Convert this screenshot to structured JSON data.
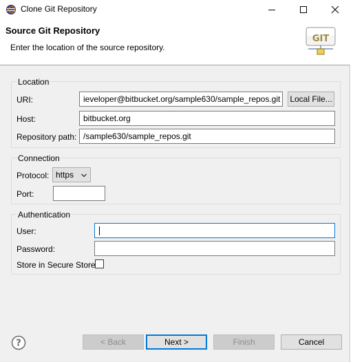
{
  "window": {
    "title": "Clone Git Repository"
  },
  "banner": {
    "title": "Source Git Repository",
    "description": "Enter the location of the source repository.",
    "logo_text": "GIT"
  },
  "location": {
    "group_title": "Location",
    "uri_label": "URI:",
    "uri_value": "ieveloper@bitbucket.org/sample630/sample_repos.git",
    "local_file_button": "Local File...",
    "host_label": "Host:",
    "host_value": "bitbucket.org",
    "repo_path_label": "Repository path:",
    "repo_path_value": "/sample630/sample_repos.git"
  },
  "connection": {
    "group_title": "Connection",
    "protocol_label": "Protocol:",
    "protocol_value": "https",
    "port_label": "Port:",
    "port_value": ""
  },
  "authentication": {
    "group_title": "Authentication",
    "user_label": "User:",
    "user_value": "",
    "password_label": "Password:",
    "password_value": "",
    "store_label": "Store in Secure Store",
    "store_checked": false
  },
  "buttons": {
    "back": "< Back",
    "next": "Next >",
    "finish": "Finish",
    "cancel": "Cancel"
  },
  "icons": {
    "app": "eclipse-icon",
    "help": "help-icon",
    "minimize": "minimize-icon",
    "maximize": "maximize-icon",
    "close": "close-icon",
    "dropdown": "chevron-down-icon"
  },
  "colors": {
    "focus": "#0078d7",
    "dialog_background": "#f0f0f0"
  }
}
